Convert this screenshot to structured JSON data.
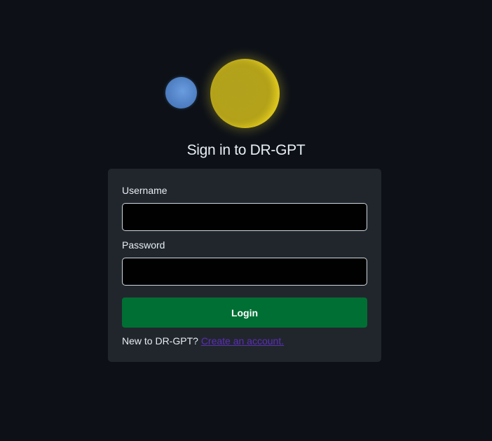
{
  "logo": {
    "small_circle_color": "#4f7fc2",
    "moon_color": "#b2a11c",
    "moon_glow_color": "#ecd21a"
  },
  "title": "Sign in to DR-GPT",
  "form": {
    "username_label": "Username",
    "username_value": "",
    "password_label": "Password",
    "password_value": "",
    "login_label": "Login"
  },
  "signup": {
    "prompt": "New to DR-GPT?",
    "link_text": "Create an account."
  },
  "colors": {
    "background": "#0d1117",
    "card": "#21262d",
    "login_button": "#006f33",
    "link": "#5b2fb5"
  }
}
